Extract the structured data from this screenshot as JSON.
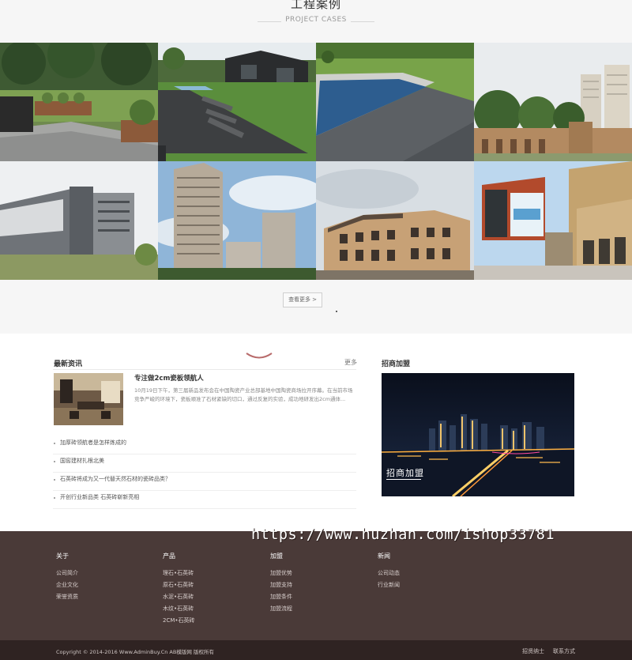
{
  "cases": {
    "title": "工程案例",
    "subtitle": "PROJECT CASES",
    "more_button": "查看更多",
    "more_arrow": ">"
  },
  "news": {
    "heading": "最新资讯",
    "more": "更多",
    "featured_title": "专注做2cm瓷板领航人",
    "featured_excerpt": "10月19日下午，第三届新品发布会在中国陶瓷产业总部基地中国陶瓷商场拉开序幕。在当前市场竞争严峻的环境下，瓷板顺准了石材紧缺的切口，通过反复的实验，成功地研发出2cm通体...",
    "items": [
      "加厚砖领航者是怎样炼成的",
      "国窖建材扎根北美",
      "石英砖将成为又一代替天然石材的瓷砖品类？",
      "开创行业新品类 石英砖崭新亮相"
    ]
  },
  "join": {
    "heading": "招商加盟",
    "image_label": "招商加盟"
  },
  "watermark": "https://www.huzhan.com/ishop33781",
  "footer": {
    "columns": [
      {
        "title": "关于",
        "links": [
          "公司简介",
          "企业文化",
          "荣誉资质"
        ]
      },
      {
        "title": "产品",
        "links": [
          "理石•石英砖",
          "原石•石英砖",
          "水泥•石英砖",
          "木纹•石英砖",
          "2CM•石英砖"
        ]
      },
      {
        "title": "加盟",
        "links": [
          "加盟优势",
          "加盟支持",
          "加盟条件",
          "加盟流程"
        ]
      },
      {
        "title": "新闻",
        "links": [
          "公司动态",
          "行业新闻"
        ]
      }
    ],
    "copyright": "Copyright © 2014-2016 Www.AdminBuy.Cn AB模版网 版权所有",
    "bottom_links": [
      "招贤纳士",
      "联系方式"
    ]
  },
  "colors": {
    "footer_bg": "#4a3a38",
    "bottom_bar_bg": "#2f2322",
    "section_bg": "#f6f6f6"
  }
}
